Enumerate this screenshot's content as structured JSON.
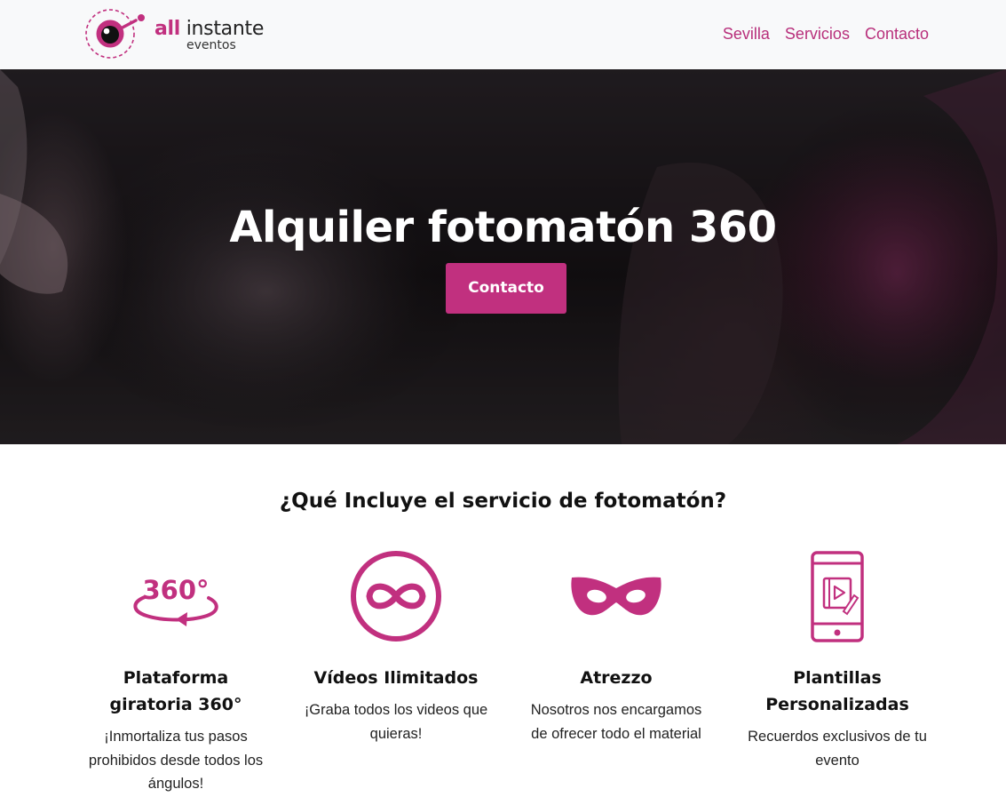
{
  "brand": {
    "name_part1": "all",
    "name_part2": " instante",
    "tagline": "eventos",
    "accent_color": "#c1307f"
  },
  "nav": {
    "items": [
      {
        "label": "Sevilla"
      },
      {
        "label": "Servicios"
      },
      {
        "label": "Contacto"
      }
    ]
  },
  "hero": {
    "title": "Alquiler fotomatón 360",
    "cta_label": "Contacto"
  },
  "services": {
    "title": "¿Qué Incluye el servicio de fotomatón?",
    "items": [
      {
        "icon": "rotation-360-icon",
        "icon_text": "360°",
        "title": "Plataforma giratoria 360°",
        "description": "¡Inmortaliza tus pasos prohibidos desde todos los ángulos!"
      },
      {
        "icon": "infinity-icon",
        "title": "Vídeos Ilimitados",
        "description": "¡Graba todos los videos que quieras!"
      },
      {
        "icon": "mask-icon",
        "title": "Atrezzo",
        "description": "Nosotros nos encargamos de ofrecer todo el material"
      },
      {
        "icon": "smartphone-video-icon",
        "title": "Plantillas Personalizadas",
        "description": "Recuerdos exclusivos de tu evento"
      }
    ]
  }
}
